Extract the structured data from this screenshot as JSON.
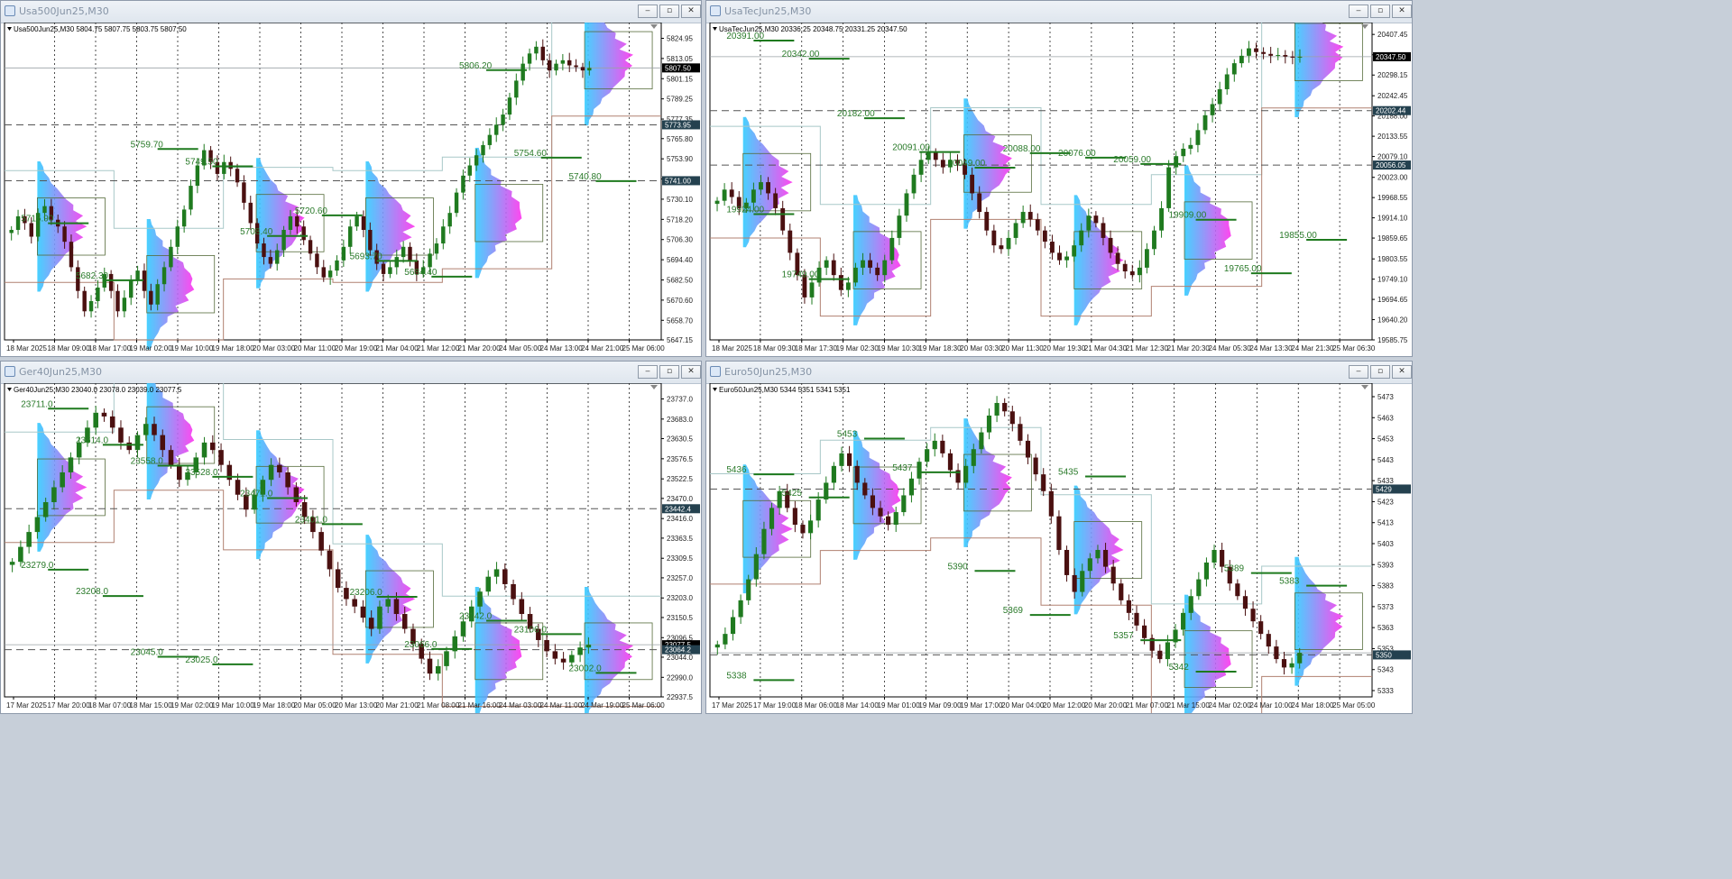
{
  "panels": [
    {
      "id": "usa500",
      "title": "Usa500Jun25,M30",
      "ohlc": "Usa500Jun25,M30  5804.75 5807.75 5803.75 5807.50",
      "ymin": 5647.15,
      "ymax": 5830.0,
      "price_ticks": [
        "5824.95",
        "5813.05",
        "5801.15",
        "5789.25",
        "5777.35",
        "5765.80",
        "5753.90",
        "5742.00",
        "5730.10",
        "5718.20",
        "5706.30",
        "5694.40",
        "5682.50",
        "5670.60",
        "5658.70",
        "5647.15"
      ],
      "price_labels": [
        {
          "value": 5807.5,
          "text": "5807.50",
          "bg": "#000000"
        },
        {
          "value": 5773.95,
          "text": "5773.95",
          "bg": "#24414f"
        },
        {
          "value": 5741.0,
          "text": "5741.00",
          "bg": "#24414f"
        }
      ],
      "dashed_levels": [
        5773.95,
        5741.0
      ],
      "last_price": 5807.5,
      "time_labels": [
        "18 Mar 2025",
        "18 Mar 09:00",
        "18 Mar 17:00",
        "19 Mar 02:00",
        "19 Mar 10:00",
        "19 Mar 18:00",
        "20 Mar 03:00",
        "20 Mar 11:00",
        "20 Mar 19:00",
        "21 Mar 04:00",
        "21 Mar 12:00",
        "21 Mar 20:00",
        "24 Mar 05:00",
        "24 Mar 13:00",
        "24 Mar 21:00",
        "25 Mar 06:00"
      ],
      "closes": [
        5712,
        5720,
        5716,
        5708,
        5722,
        5726,
        5718,
        5714,
        5705,
        5690,
        5676,
        5664,
        5670,
        5678,
        5686,
        5676,
        5664,
        5672,
        5682,
        5688,
        5676,
        5668,
        5680,
        5690,
        5702,
        5714,
        5724,
        5738,
        5750,
        5759,
        5752,
        5745,
        5752,
        5748,
        5740,
        5728,
        5716,
        5704,
        5696,
        5692,
        5700,
        5712,
        5720,
        5714,
        5706,
        5698,
        5690,
        5684,
        5688,
        5694,
        5702,
        5714,
        5720,
        5712,
        5700,
        5692,
        5686,
        5690,
        5696,
        5702,
        5694,
        5686,
        5690,
        5698,
        5704,
        5714,
        5722,
        5734,
        5744,
        5750,
        5756,
        5762,
        5768,
        5774,
        5780,
        5790,
        5800,
        5810,
        5816,
        5820,
        5812,
        5806,
        5810,
        5812,
        5809,
        5808,
        5806,
        5807.5
      ],
      "levels": [
        {
          "text": "5715.90",
          "price": 5715.9
        },
        {
          "text": "5682.30",
          "price": 5682.3
        },
        {
          "text": "5759.70",
          "price": 5759.7
        },
        {
          "text": "5749.50",
          "price": 5749.5
        },
        {
          "text": "5708.40",
          "price": 5708.4
        },
        {
          "text": "5720.60",
          "price": 5720.6
        },
        {
          "text": "5693.70",
          "price": 5693.7
        },
        {
          "text": "5684.40",
          "price": 5684.4
        },
        {
          "text": "5806.20",
          "price": 5806.2
        },
        {
          "text": "5754.60",
          "price": 5754.6
        },
        {
          "text": "5740.80",
          "price": 5740.8
        }
      ]
    },
    {
      "id": "usatec",
      "title": "UsaTecJun25,M30",
      "ohlc": "UsaTecJun25,M30  20336.25 20348.75 20331.25 20347.50",
      "ymin": 19585.75,
      "ymax": 20420.0,
      "price_ticks": [
        "20407.45",
        "20352.70",
        "20298.15",
        "20242.45",
        "20188.00",
        "20133.55",
        "20079.10",
        "20023.00",
        "19968.55",
        "19914.10",
        "19859.65",
        "19803.55",
        "19749.10",
        "19694.65",
        "19640.20",
        "19585.75"
      ],
      "price_labels": [
        {
          "value": 20347.5,
          "text": "20347.50",
          "bg": "#000000"
        },
        {
          "value": 20202.44,
          "text": "20202.44",
          "bg": "#24414f"
        },
        {
          "value": 20056.05,
          "text": "20056.05",
          "bg": "#24414f"
        }
      ],
      "dashed_levels": [
        20202.44,
        20056.05
      ],
      "last_price": 20347.5,
      "time_labels": [
        "18 Mar 2025",
        "18 Mar 09:30",
        "18 Mar 17:30",
        "19 Mar 02:30",
        "19 Mar 10:30",
        "19 Mar 18:30",
        "20 Mar 03:30",
        "20 Mar 11:30",
        "20 Mar 19:30",
        "21 Mar 04:30",
        "21 Mar 12:30",
        "21 Mar 20:30",
        "24 Mar 05:30",
        "24 Mar 13:30",
        "24 Mar 21:30",
        "25 Mar 06:30"
      ],
      "closes": [
        19960,
        19990,
        19970,
        19940,
        19955,
        19990,
        20010,
        19980,
        19940,
        19880,
        19820,
        19760,
        19700,
        19740,
        19780,
        19800,
        19760,
        19720,
        19740,
        19780,
        19800,
        19780,
        19760,
        19800,
        19860,
        19920,
        19980,
        20030,
        20070,
        20090,
        20070,
        20050,
        20070,
        20060,
        20030,
        19980,
        19930,
        19880,
        19840,
        19830,
        19860,
        19900,
        19930,
        19910,
        19880,
        19850,
        19820,
        19800,
        19810,
        19840,
        19880,
        19920,
        19900,
        19860,
        19820,
        19790,
        19770,
        19760,
        19780,
        19830,
        19880,
        19940,
        20050,
        20080,
        20100,
        20110,
        20150,
        20190,
        20220,
        20260,
        20300,
        20330,
        20350,
        20370,
        20360,
        20355,
        20350,
        20352,
        20348,
        20345,
        20347.5
      ],
      "levels": [
        {
          "text": "20391.00",
          "price": 20391.0
        },
        {
          "text": "20342.00",
          "price": 20342.0
        },
        {
          "text": "20182.00",
          "price": 20182.0
        },
        {
          "text": "20091.00",
          "price": 20091.0
        },
        {
          "text": "20049.00",
          "price": 20049.0
        },
        {
          "text": "20088.00",
          "price": 20088.0
        },
        {
          "text": "20076.00",
          "price": 20076.0
        },
        {
          "text": "20059.00",
          "price": 20059.0
        },
        {
          "text": "19909.00",
          "price": 19909.0
        },
        {
          "text": "19765.00",
          "price": 19765.0
        },
        {
          "text": "19855.00",
          "price": 19855.0
        },
        {
          "text": "19924.00",
          "price": 19924.0
        },
        {
          "text": "19749.00",
          "price": 19749.0
        }
      ]
    },
    {
      "id": "ger40",
      "title": "Ger40Jun25,M30",
      "ohlc": "Ger40Jun25,M30  23040.0 23078.0 23039.0 23077.5",
      "ymin": 22937.5,
      "ymax": 23760.0,
      "price_ticks": [
        "23737.0",
        "23683.0",
        "23630.5",
        "23576.5",
        "23522.5",
        "23470.0",
        "23416.0",
        "23363.5",
        "23309.5",
        "23257.0",
        "23203.0",
        "23150.5",
        "23096.5",
        "23044.0",
        "22990.0",
        "22937.5"
      ],
      "price_labels": [
        {
          "value": 23077.5,
          "text": "23077.5",
          "bg": "#000000"
        },
        {
          "value": 23442.4,
          "text": "23442.4",
          "bg": "#24414f"
        },
        {
          "value": 23064.2,
          "text": "23064.2",
          "bg": "#24414f"
        }
      ],
      "dashed_levels": [
        23442.4,
        23064.2
      ],
      "last_price": 23077.5,
      "time_labels": [
        "17 Mar 2025",
        "17 Mar 20:00",
        "18 Mar 07:00",
        "18 Mar 15:00",
        "19 Mar 02:00",
        "19 Mar 10:00",
        "19 Mar 18:00",
        "20 Mar 05:00",
        "20 Mar 13:00",
        "20 Mar 21:00",
        "21 Mar 08:00",
        "21 Mar 16:00",
        "24 Mar 03:00",
        "24 Mar 11:00",
        "24 Mar 19:00",
        "25 Mar 06:00"
      ],
      "closes": [
        23300,
        23340,
        23380,
        23420,
        23460,
        23500,
        23540,
        23580,
        23620,
        23660,
        23700,
        23690,
        23660,
        23620,
        23600,
        23640,
        23670,
        23640,
        23600,
        23560,
        23520,
        23540,
        23580,
        23620,
        23600,
        23560,
        23520,
        23480,
        23440,
        23480,
        23520,
        23560,
        23540,
        23500,
        23460,
        23420,
        23380,
        23330,
        23280,
        23230,
        23200,
        23180,
        23150,
        23120,
        23180,
        23200,
        23160,
        23120,
        23080,
        23040,
        23000,
        23020,
        23060,
        23100,
        23140,
        23180,
        23220,
        23260,
        23280,
        23240,
        23200,
        23160,
        23120,
        23090,
        23060,
        23040,
        23030,
        23050,
        23070,
        23077.5
      ],
      "levels": [
        {
          "text": "23711.0",
          "price": 23711.0
        },
        {
          "text": "23614.0",
          "price": 23614.0
        },
        {
          "text": "23558.0",
          "price": 23558.0
        },
        {
          "text": "23528.0",
          "price": 23528.0
        },
        {
          "text": "23471.0",
          "price": 23471.0
        },
        {
          "text": "23401.0",
          "price": 23401.0
        },
        {
          "text": "23206.0",
          "price": 23206.0
        },
        {
          "text": "23066.0",
          "price": 23066.0
        },
        {
          "text": "23142.0",
          "price": 23142.0
        },
        {
          "text": "23106.0",
          "price": 23106.0
        },
        {
          "text": "23002.0",
          "price": 23002.0
        },
        {
          "text": "23279.0",
          "price": 23279.0
        },
        {
          "text": "23208.0",
          "price": 23208.0
        },
        {
          "text": "23045.0",
          "price": 23045.0
        },
        {
          "text": "23025.0",
          "price": 23025.0
        }
      ]
    },
    {
      "id": "euro50",
      "title": "Euro50Jun25,M30",
      "ohlc": "Euro50Jun25,M30  5344 5351 5341 5351",
      "ymin": 5330,
      "ymax": 5476,
      "price_ticks": [
        "5473",
        "5463",
        "5453",
        "5443",
        "5433",
        "5423",
        "5413",
        "5403",
        "5393",
        "5383",
        "5373",
        "5363",
        "5353",
        "5343",
        "5333"
      ],
      "price_labels": [
        {
          "value": 5429,
          "text": "5429",
          "bg": "#24414f"
        },
        {
          "value": 5350,
          "text": "5350",
          "bg": "#24414f"
        }
      ],
      "dashed_levels": [
        5429,
        5350
      ],
      "last_price": 5351,
      "time_labels": [
        "17 Mar 2025",
        "17 Mar 19:00",
        "18 Mar 06:00",
        "18 Mar 14:00",
        "19 Mar 01:00",
        "19 Mar 09:00",
        "19 Mar 17:00",
        "20 Mar 04:00",
        "20 Mar 12:00",
        "20 Mar 20:00",
        "21 Mar 07:00",
        "21 Mar 15:00",
        "24 Mar 02:00",
        "24 Mar 10:00",
        "24 Mar 18:00",
        "25 Mar 05:00"
      ],
      "closes": [
        5355,
        5360,
        5368,
        5376,
        5386,
        5398,
        5410,
        5420,
        5428,
        5420,
        5412,
        5408,
        5414,
        5424,
        5432,
        5440,
        5446,
        5440,
        5432,
        5426,
        5420,
        5416,
        5412,
        5418,
        5426,
        5434,
        5442,
        5448,
        5452,
        5446,
        5438,
        5432,
        5440,
        5448,
        5456,
        5464,
        5470,
        5466,
        5460,
        5452,
        5444,
        5436,
        5428,
        5416,
        5400,
        5388,
        5380,
        5390,
        5396,
        5400,
        5392,
        5384,
        5376,
        5370,
        5364,
        5358,
        5352,
        5348,
        5356,
        5362,
        5370,
        5378,
        5386,
        5394,
        5400,
        5392,
        5384,
        5378,
        5372,
        5366,
        5360,
        5354,
        5348,
        5344,
        5346,
        5351
      ],
      "levels": [
        {
          "text": "5436",
          "price": 5436
        },
        {
          "text": "5425",
          "price": 5425
        },
        {
          "text": "5453",
          "price": 5453
        },
        {
          "text": "5437",
          "price": 5437
        },
        {
          "text": "5390",
          "price": 5390
        },
        {
          "text": "5369",
          "price": 5369
        },
        {
          "text": "5435",
          "price": 5435
        },
        {
          "text": "5357",
          "price": 5357
        },
        {
          "text": "5342",
          "price": 5342
        },
        {
          "text": "5389",
          "price": 5389
        },
        {
          "text": "5383",
          "price": 5383
        },
        {
          "text": "5338",
          "price": 5338
        }
      ]
    }
  ],
  "buttons": {
    "min": "‒",
    "restore": "▫",
    "close": "✕"
  },
  "colors": {
    "up": "#1f7a1f",
    "down": "#4a1010",
    "level": "#2a7a2a",
    "profile_a": "#ff33ee",
    "profile_b": "#33ccff",
    "value_area": "#b08070",
    "dashed": "#555555"
  }
}
